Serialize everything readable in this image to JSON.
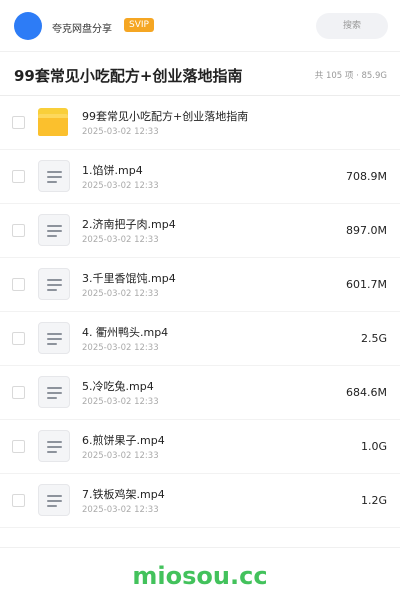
{
  "header": {
    "user_name": "夸克网盘分享",
    "badge": "SVIP",
    "search_label": "搜索",
    "colors": {
      "avatar": "#2d7cf6",
      "badge": "#f5a623"
    }
  },
  "page": {
    "title": "99套常见小吃配方+创业落地指南",
    "meta": "共 105 项 · 85.9G"
  },
  "items": [
    {
      "name": "99套常见小吃配方+创业落地指南",
      "date": "2025-03-02 12:33",
      "size": "",
      "type": "folder",
      "icon": "folder-icon"
    },
    {
      "name": "1.馅饼.mp4",
      "date": "2025-03-02 12:33",
      "size": "708.9M",
      "type": "file",
      "icon": "file-icon"
    },
    {
      "name": "2.济南把子肉.mp4",
      "date": "2025-03-02 12:33",
      "size": "897.0M",
      "type": "file",
      "icon": "file-icon"
    },
    {
      "name": "3.千里香馄饨.mp4",
      "date": "2025-03-02 12:33",
      "size": "601.7M",
      "type": "file",
      "icon": "file-icon"
    },
    {
      "name": "4. 衢州鸭头.mp4",
      "date": "2025-03-02 12:33",
      "size": "2.5G",
      "type": "file",
      "icon": "file-icon"
    },
    {
      "name": "5.冷吃兔.mp4",
      "date": "2025-03-02 12:33",
      "size": "684.6M",
      "type": "file",
      "icon": "file-icon"
    },
    {
      "name": "6.煎饼果子.mp4",
      "date": "2025-03-02 12:33",
      "size": "1.0G",
      "type": "file",
      "icon": "file-icon"
    },
    {
      "name": "7.铁板鸡架.mp4",
      "date": "2025-03-02 12:33",
      "size": "1.2G",
      "type": "file",
      "icon": "file-icon"
    }
  ],
  "footer": {
    "brand": "miosou.cc",
    "color": "#43c25c"
  }
}
